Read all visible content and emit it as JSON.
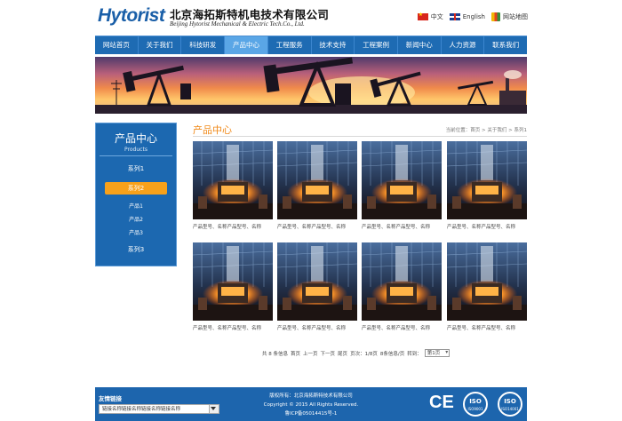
{
  "header": {
    "logo_en": "Hytorist",
    "company_cn": "北京海拓斯特机电技术有限公司",
    "company_en": "Beijing Hytorist Mechanical & Electric Tech.Co., Ltd.",
    "links": {
      "chinese": "中文",
      "english": "English",
      "sitemap": "网站地图"
    }
  },
  "nav": {
    "items": [
      "网站首页",
      "关于我们",
      "科技研发",
      "产品中心",
      "工程服务",
      "技术支持",
      "工程案例",
      "新闻中心",
      "人力资源",
      "联系我们"
    ],
    "active_index": 3
  },
  "sidebar": {
    "title": "产品中心",
    "subtitle": "Products",
    "categories": [
      "系列1",
      "系列2",
      "系列3"
    ],
    "sub_items": [
      "产品1",
      "产品2",
      "产品3"
    ],
    "active_category": "系列2"
  },
  "content": {
    "section_title": "产品中心",
    "breadcrumb": "当前位置：首页 > 关于我们 > 系列1",
    "products": [
      {
        "caption": "产品型号、名称产品型号、名称"
      },
      {
        "caption": "产品型号、名称产品型号、名称"
      },
      {
        "caption": "产品型号、名称产品型号、名称"
      },
      {
        "caption": "产品型号、名称产品型号、名称"
      },
      {
        "caption": "产品型号、名称产品型号、名称"
      },
      {
        "caption": "产品型号、名称产品型号、名称"
      },
      {
        "caption": "产品型号、名称产品型号、名称"
      },
      {
        "caption": "产品型号、名称产品型号、名称"
      }
    ],
    "pager": {
      "summary": "共 8 条信息",
      "first": "首页",
      "prev": "上一页",
      "next": "下一页",
      "last": "尾页",
      "page_info": "页次：1/8页",
      "per_page": "8条信息/页",
      "jump_label": "转到：",
      "jump_value": "第1页"
    }
  },
  "footer": {
    "links_label": "友情链接",
    "links_select": "链接名称链接名称链接名称链接名称",
    "copyright_owner": "版权所有：北京海拓斯特技术有限公司",
    "copyright": "Copyright © 2015  All Rights Reserved.",
    "icp": "鲁ICP备05014415号-1",
    "certs": {
      "ce": "CE",
      "iso1_title": "ISO",
      "iso1_code": "ISO9001",
      "iso2_title": "ISO",
      "iso2_code": "ISO14001"
    }
  },
  "colors": {
    "brand_blue": "#1e6bb3",
    "accent_orange": "#f7a11a",
    "title_orange": "#f08a1a"
  }
}
